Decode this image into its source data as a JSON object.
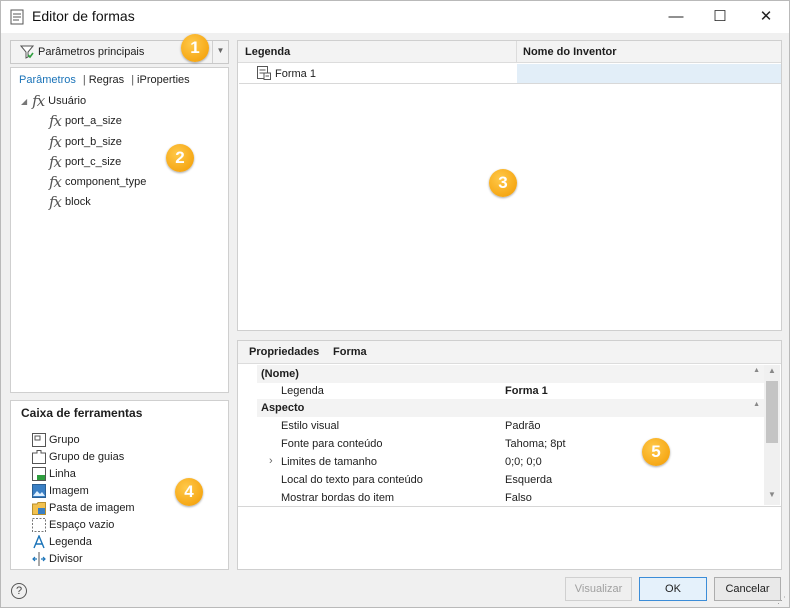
{
  "window": {
    "title": "Editor de formas",
    "min": "—",
    "max": "☐",
    "close": "✕"
  },
  "filter": {
    "selected": "Parâmetros principais"
  },
  "tabs": [
    "Parâmetros",
    "Regras",
    "iProperties"
  ],
  "tree": {
    "root": "Usuário",
    "items": [
      "port_a_size",
      "port_b_size",
      "port_c_size",
      "component_type",
      "block"
    ]
  },
  "toolbox": {
    "title": "Caixa de ferramentas",
    "items": [
      "Grupo",
      "Grupo de guias",
      "Linha",
      "Imagem",
      "Pasta de imagem",
      "Espaço vazio",
      "Legenda",
      "Divisor"
    ]
  },
  "grid": {
    "headers": [
      "Legenda",
      "Nome do Inventor"
    ],
    "rows": [
      {
        "legenda": "Forma 1",
        "nome": ""
      }
    ]
  },
  "properties": {
    "header_label": "Propriedades",
    "header_value": "Forma",
    "rows": [
      {
        "type": "category",
        "name": "(Nome)"
      },
      {
        "type": "prop",
        "name": "Legenda",
        "value": "Forma 1",
        "bold": true
      },
      {
        "type": "category",
        "name": "Aspecto"
      },
      {
        "type": "prop",
        "name": "Estilo visual",
        "value": "Padrão"
      },
      {
        "type": "prop",
        "name": "Fonte para conteúdo",
        "value": "Tahoma; 8pt"
      },
      {
        "type": "prop",
        "name": "Limites de tamanho",
        "value": "0;0; 0;0",
        "expandable": true
      },
      {
        "type": "prop",
        "name": "Local do texto para conteúdo",
        "value": "Esquerda"
      },
      {
        "type": "prop",
        "name": "Mostrar bordas do item",
        "value": "Falso"
      }
    ]
  },
  "callouts": [
    "1",
    "2",
    "3",
    "4",
    "5"
  ],
  "buttons": {
    "preview": "Visualizar",
    "ok": "OK",
    "cancel": "Cancelar",
    "help": "?"
  },
  "colors": {
    "accent": "#1a73b8",
    "callout": "#f5a300",
    "selection": "#e2eef8"
  }
}
